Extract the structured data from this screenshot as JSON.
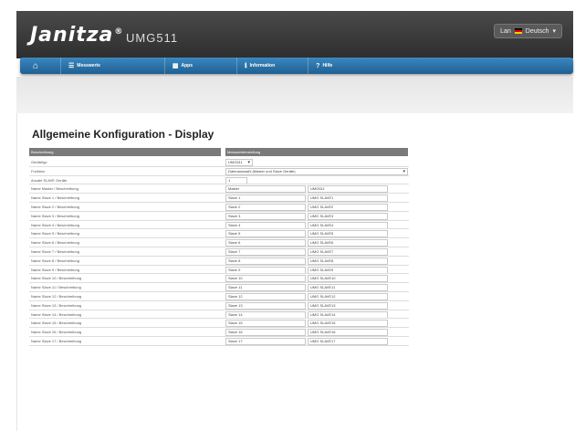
{
  "header": {
    "brand": "Janitza",
    "brand_mark": "®",
    "product": "UMG511",
    "language_prefix": "Lan",
    "language": "Deutsch"
  },
  "nav": {
    "items": [
      {
        "label": "Messwerte",
        "icon": "list-icon"
      },
      {
        "label": "Apps",
        "icon": "grid-icon"
      },
      {
        "label": "Information",
        "icon": "info-icon"
      },
      {
        "label": "Hilfe",
        "icon": "help-icon"
      }
    ]
  },
  "page": {
    "title": "Allgemeine Konfiguration - Display",
    "col_desc": "Beschreibung",
    "col_val": "Messwerteinstellung"
  },
  "rows": {
    "geraet": {
      "label": "Gerätetyp",
      "value": "UMG511"
    },
    "funktion": {
      "label": "Funktion",
      "value": "Datenauswahl (Master und Slave Geräte)"
    },
    "anzahl": {
      "label": "Anzahl SLAVE Geräte",
      "value": "1"
    },
    "master": {
      "label": "Name Master / Beschreibung",
      "a": "Master",
      "b": "UMG511"
    },
    "slaves": [
      {
        "label": "Name Slave 1 / Beschreibung",
        "a": "Slave 1",
        "b": "UMG SLAVE1"
      },
      {
        "label": "Name Slave 2 / Beschreibung",
        "a": "Slave 2",
        "b": "UMG SLAVE2"
      },
      {
        "label": "Name Slave 3 / Beschreibung",
        "a": "Slave 3",
        "b": "UMG SLAVE3"
      },
      {
        "label": "Name Slave 4 / Beschreibung",
        "a": "Slave 4",
        "b": "UMG SLAVE4"
      },
      {
        "label": "Name Slave 5 / Beschreibung",
        "a": "Slave 5",
        "b": "UMG SLAVE5"
      },
      {
        "label": "Name Slave 6 / Beschreibung",
        "a": "Slave 6",
        "b": "UMG SLAVE6"
      },
      {
        "label": "Name Slave 7 / Beschreibung",
        "a": "Slave 7",
        "b": "UMG SLAVE7"
      },
      {
        "label": "Name Slave 8 / Beschreibung",
        "a": "Slave 8",
        "b": "UMG SLAVE8"
      },
      {
        "label": "Name Slave 9 / Beschreibung",
        "a": "Slave 9",
        "b": "UMG SLAVE9"
      },
      {
        "label": "Name Slave 10 / Beschreibung",
        "a": "Slave 10",
        "b": "UMG SLAVE10"
      },
      {
        "label": "Name Slave 11 / Beschreibung",
        "a": "Slave 11",
        "b": "UMG SLAVE11"
      },
      {
        "label": "Name Slave 12 / Beschreibung",
        "a": "Slave 12",
        "b": "UMG SLAVE12"
      },
      {
        "label": "Name Slave 13 / Beschreibung",
        "a": "Slave 13",
        "b": "UMG SLAVE13"
      },
      {
        "label": "Name Slave 14 / Beschreibung",
        "a": "Slave 14",
        "b": "UMG SLAVE14"
      },
      {
        "label": "Name Slave 15 / Beschreibung",
        "a": "Slave 15",
        "b": "UMG SLAVE15"
      },
      {
        "label": "Name Slave 16 / Beschreibung",
        "a": "Slave 16",
        "b": "UMG SLAVE16"
      },
      {
        "label": "Name Slave 17 / Beschreibung",
        "a": "Slave 17",
        "b": "UMG SLAVE17"
      }
    ]
  },
  "colors": {
    "header": "#3a3a3a",
    "nav": "#2a70a8",
    "column_header": "#7a7a7a"
  }
}
